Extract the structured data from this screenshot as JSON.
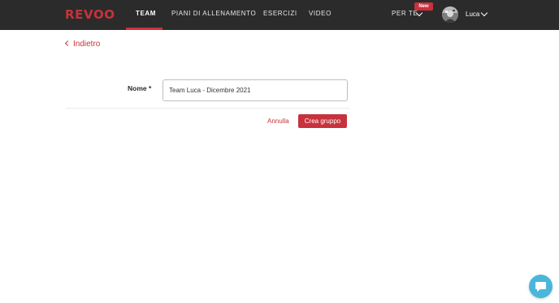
{
  "app": {
    "logo": "REVOO",
    "accent_color": "#c8323c",
    "topbar_color": "#2b2b2b"
  },
  "nav": {
    "items": [
      {
        "label": "TEAM",
        "active": true
      },
      {
        "label": "PIANI DI ALLENAMENTO",
        "active": false
      },
      {
        "label": "ESERCIZI",
        "active": false
      },
      {
        "label": "VIDEO",
        "active": false
      }
    ],
    "per_te": {
      "label": "PER TE",
      "badge": "New",
      "icon": "chevron-down-icon"
    },
    "user": {
      "name": "Luca",
      "avatar": "avatar-photo",
      "icon": "chevron-down-icon"
    }
  },
  "page": {
    "back_label": "Indietro",
    "form": {
      "name_label": "Nome *",
      "name_value": "Team Luca - Dicembre 2021"
    },
    "actions": {
      "cancel_label": "Annulla",
      "create_label": "Crea gruppo"
    }
  },
  "chat_widget": {
    "icon": "chat-bubble-icon",
    "color": "#4ab6dc"
  }
}
